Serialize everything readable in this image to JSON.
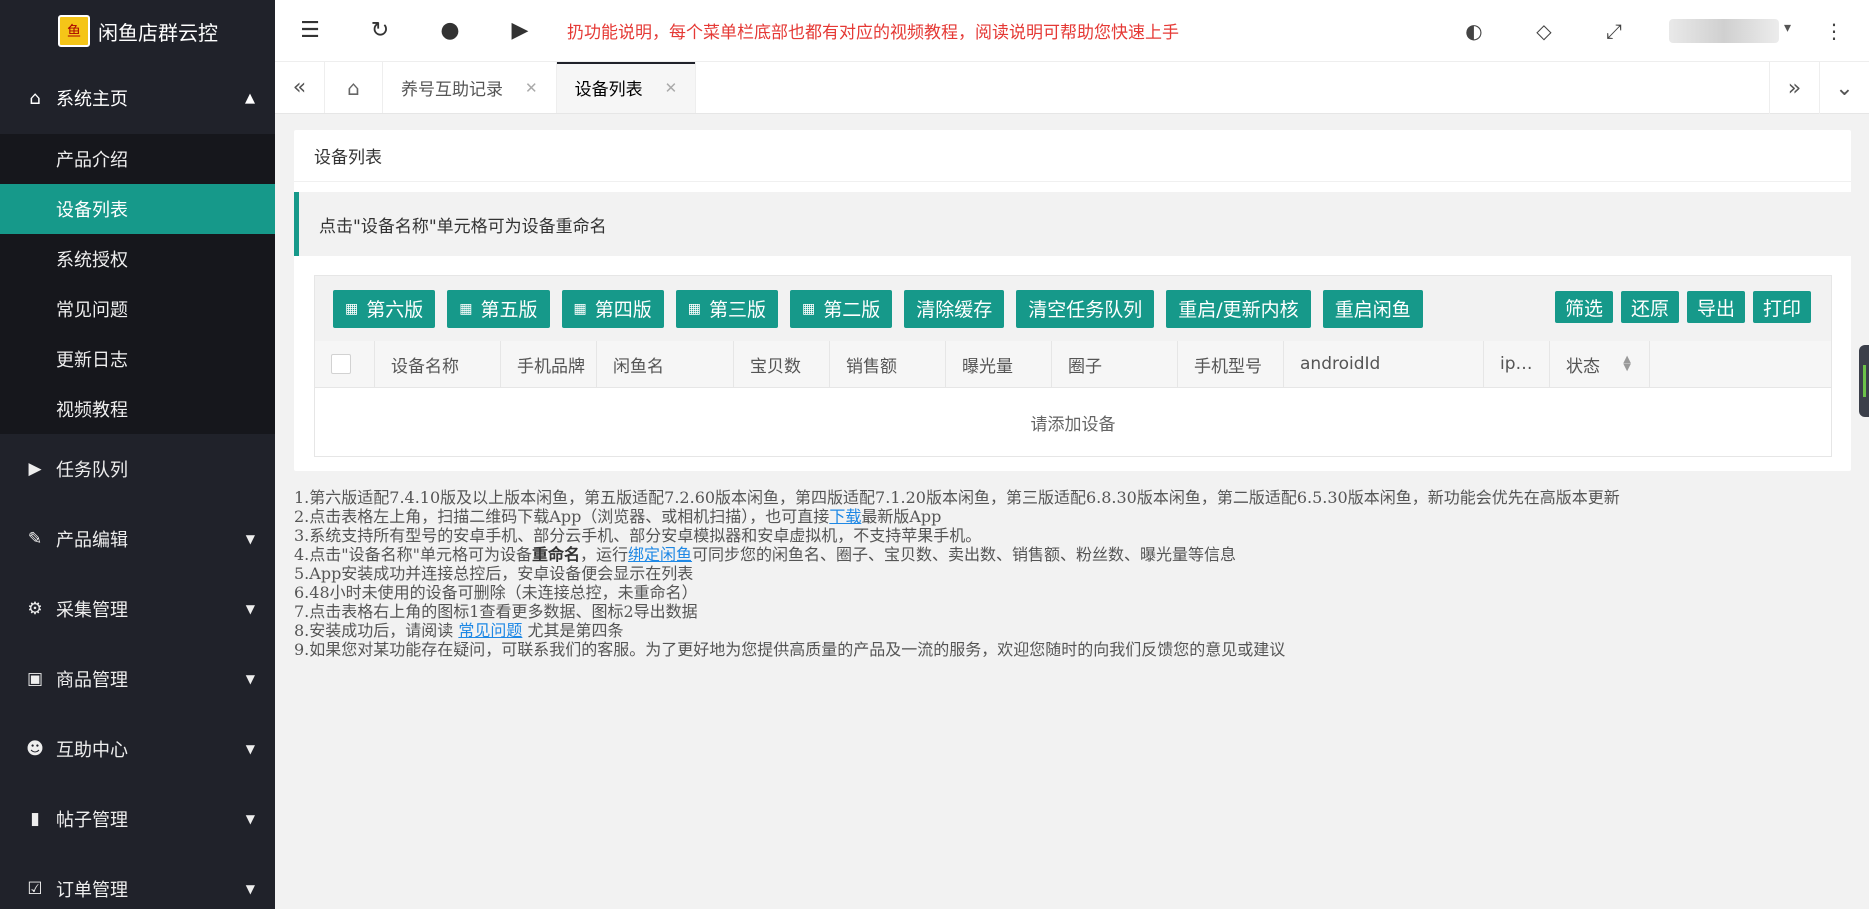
{
  "sidebar": {
    "logo_text": "闲鱼店群云控",
    "logo_badge": "鱼",
    "home": {
      "label": "系统主页",
      "icon": "home-icon"
    },
    "sub_items": [
      {
        "label": "产品介绍"
      },
      {
        "label": "设备列表",
        "active": true
      },
      {
        "label": "系统授权"
      },
      {
        "label": "常见问题"
      },
      {
        "label": "更新日志"
      },
      {
        "label": "视频教程"
      }
    ],
    "groups": [
      {
        "label": "任务队列",
        "icon": "play-icon"
      },
      {
        "label": "产品编辑",
        "icon": "edit-icon"
      },
      {
        "label": "采集管理",
        "icon": "gear-icon"
      },
      {
        "label": "商品管理",
        "icon": "bag-icon"
      },
      {
        "label": "互助中心",
        "icon": "users-icon"
      },
      {
        "label": "帖子管理",
        "icon": "book-icon"
      },
      {
        "label": "订单管理",
        "icon": "clipboard-icon"
      }
    ]
  },
  "header": {
    "notice": "扔功能说明，每个菜单栏底部也都有对应的视频教程，阅读说明可帮助您快速上手"
  },
  "tabs": [
    {
      "label": "养号互助记录"
    },
    {
      "label": "设备列表",
      "active": true
    }
  ],
  "card": {
    "title": "设备列表",
    "tip": "点击\"设备名称\"单元格可为设备重命名"
  },
  "toolbar": {
    "buttons": [
      "第六版",
      "第五版",
      "第四版",
      "第三版",
      "第二版",
      "清除缓存",
      "清空任务队列",
      "重启/更新内核",
      "重启闲鱼"
    ],
    "right_buttons": [
      "筛选",
      "还原",
      "导出",
      "打印"
    ]
  },
  "table": {
    "columns": [
      "设备名称",
      "手机品牌",
      "闲鱼名",
      "宝贝数",
      "销售额",
      "曝光量",
      "圈子",
      "手机型号",
      "androidId",
      "ip…",
      "状态"
    ],
    "empty_text": "请添加设备"
  },
  "notes": {
    "n1": "1.第六版适配7.4.10版及以上版本闲鱼，第五版适配7.2.60版本闲鱼，第四版适配7.1.20版本闲鱼，第三版适配6.8.30版本闲鱼，第二版适配6.5.30版本闲鱼，新功能会优先在高版本更新",
    "n2_pre": "2.点击表格左上角，扫描二维码下载App（浏览器、或相机扫描），也可直接",
    "n2_link": "下载",
    "n2_post": "最新版App",
    "n3": "3.系统支持所有型号的安卓手机、部分云手机、部分安卓模拟器和安卓虚拟机，不支持苹果手机。",
    "n4_pre": "4.点击\"设备名称\"单元格可为设备",
    "n4_bold": "重命名",
    "n4_mid": "，运行",
    "n4_link": "绑定闲鱼",
    "n4_post": "可同步您的闲鱼名、圈子、宝贝数、卖出数、销售额、粉丝数、曝光量等信息",
    "n5": "5.App安装成功并连接总控后，安卓设备便会显示在列表",
    "n6": "6.48小时未使用的设备可删除（未连接总控，未重命名）",
    "n7": "7.点击表格右上角的图标1查看更多数据、图标2导出数据",
    "n8_pre": "8.安装成功后，请阅读 ",
    "n8_link": "常见问题",
    "n8_post": " 尤其是第四条",
    "n9": "9.如果您对某功能存在疑问，可联系我们的客服。为了更好地为您提供高质量的产品及一流的服务，欢迎您随时的向我们反馈您的意见或建议"
  }
}
